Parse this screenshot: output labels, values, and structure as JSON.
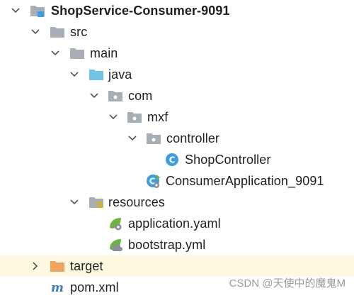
{
  "tree": {
    "root_label": "ShopService-Consumer-9091",
    "src_label": "src",
    "main_label": "main",
    "java_label": "java",
    "com_label": "com",
    "mxf_label": "mxf",
    "controller_label": "controller",
    "shopcontroller_label": "ShopController",
    "consumerapp_label": "ConsumerApplication_9091",
    "resources_label": "resources",
    "application_yaml_label": "application.yaml",
    "bootstrap_label": "bootstrap.yml",
    "target_label": "target",
    "pom_label": "pom.xml"
  },
  "watermark": "CSDN @天使中的魔鬼M",
  "colors": {
    "folder_gray": "#a8aeb5",
    "folder_blue": "#6fc3e6",
    "folder_orange": "#f0a35d",
    "class_blue": "#3c9ee0",
    "spring_green": "#6db33f",
    "maven_blue": "#3b7bc5",
    "highlight": "#fcf9e0"
  }
}
